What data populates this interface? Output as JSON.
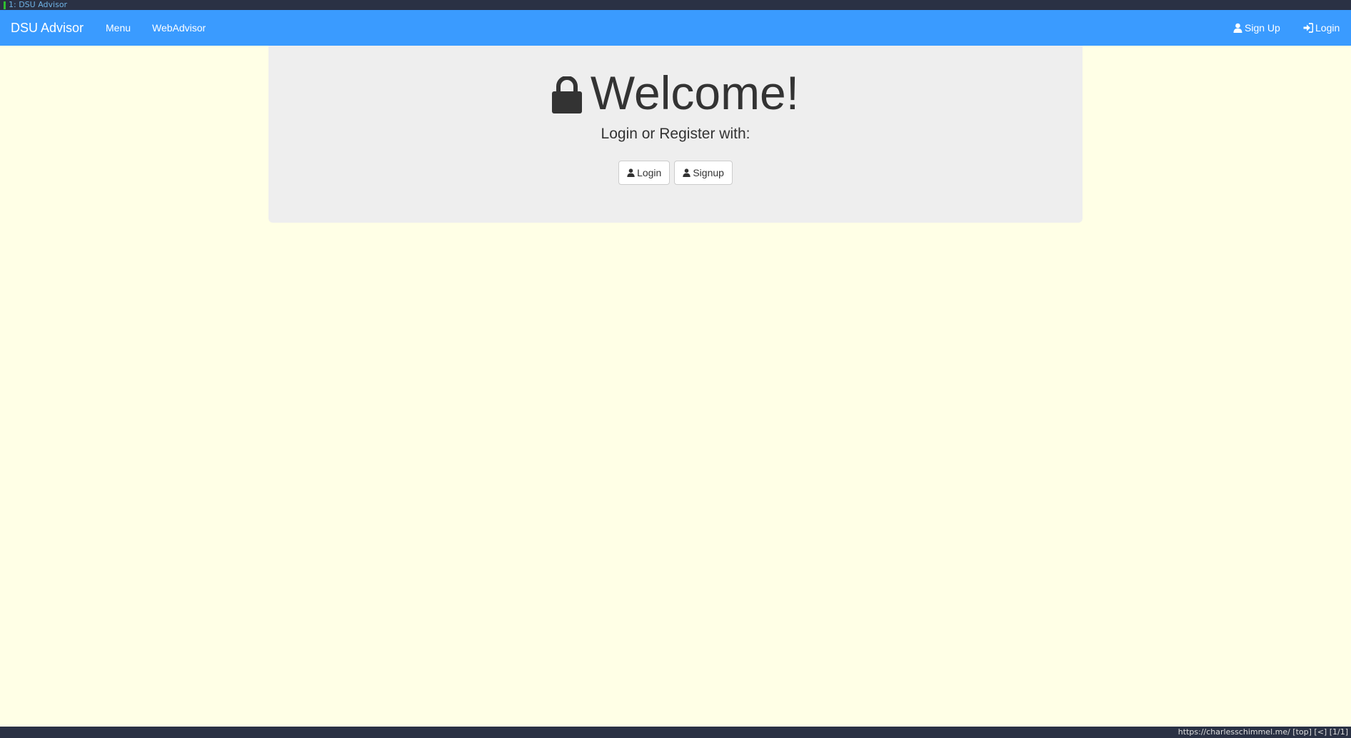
{
  "browser": {
    "tab_title": "1: DSU Advisor",
    "status_url": "https://charlesschimmel.me/ [top] [<] [1/1]"
  },
  "navbar": {
    "brand": "DSU Advisor",
    "links": [
      "Menu",
      "WebAdvisor"
    ],
    "signup_label": "Sign Up",
    "login_label": "Login",
    "background_color": "#3a9bff"
  },
  "jumbotron": {
    "icon": "lock-icon",
    "title": "Welcome!",
    "subtitle": "Login or Register with:",
    "login_button": "Login",
    "signup_button": "Signup"
  },
  "colors": {
    "page_background": "#ffffe6",
    "jumbotron_background": "#eeeeee"
  }
}
